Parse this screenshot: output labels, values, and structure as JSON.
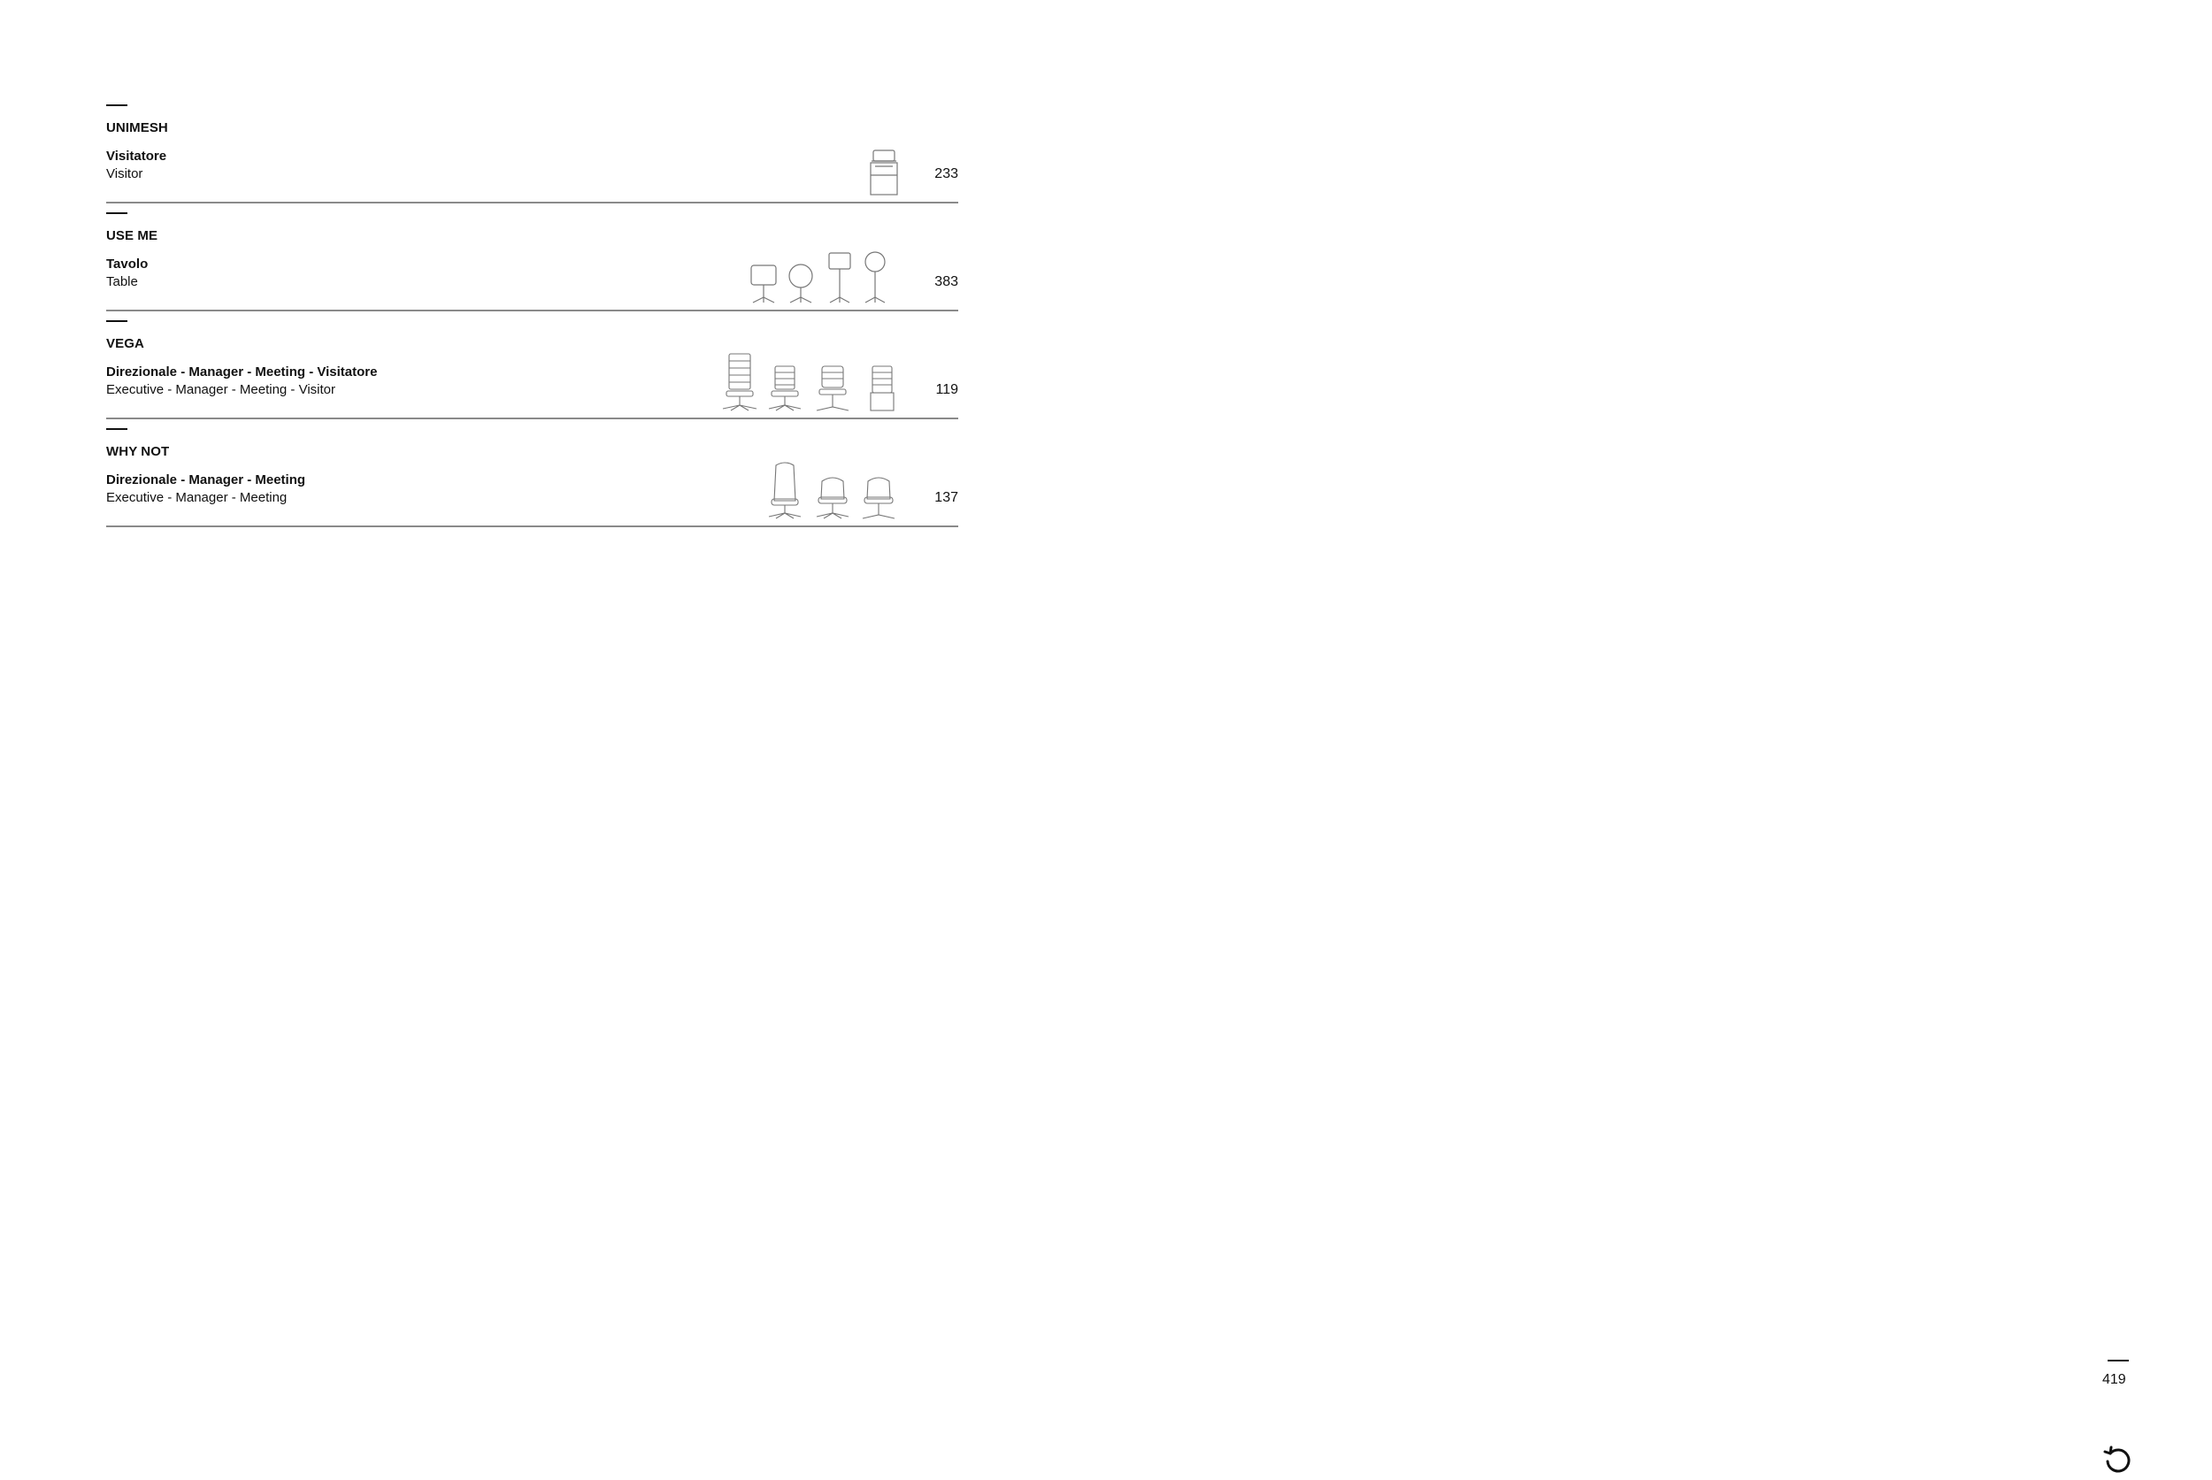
{
  "entries": [
    {
      "name": "UNIMESH",
      "it": "Visitatore",
      "en": "Visitor",
      "page": "233",
      "icons": [
        "visitor-chair-icon"
      ]
    },
    {
      "name": "USE ME",
      "it": "Tavolo",
      "en": "Table",
      "page": "383",
      "icons": [
        "square-table-icon",
        "round-table-icon",
        "square-high-table-icon",
        "round-high-table-icon"
      ]
    },
    {
      "name": "VEGA",
      "it": "Direzionale - Manager - Meeting - Visitatore",
      "en": "Executive - Manager - Meeting - Visitor",
      "page": "119",
      "icons": [
        "executive-chair-icon",
        "manager-chair-icon",
        "meeting-chair-icon",
        "visitor-chair-icon"
      ]
    },
    {
      "name": "WHY NOT",
      "it": "Direzionale - Manager - Meeting",
      "en": "Executive - Manager - Meeting",
      "page": "137",
      "icons": [
        "executive-chair-icon",
        "manager-chair-icon",
        "meeting-chair-icon"
      ]
    }
  ],
  "footer": {
    "page_number": "419",
    "reload_icon": "reload-icon"
  }
}
